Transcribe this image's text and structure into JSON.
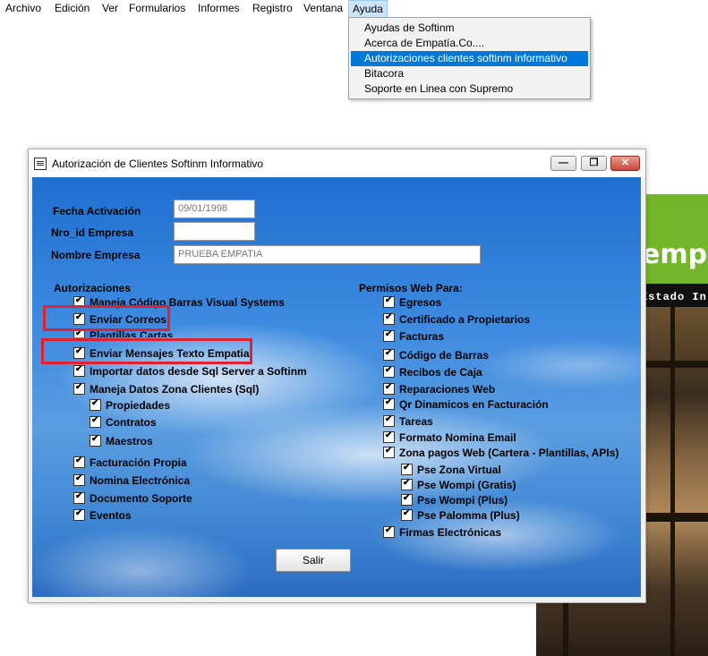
{
  "menu": {
    "items": [
      "Archivo",
      "Edición",
      "Ver",
      "Formularios",
      "Informes",
      "Registro",
      "Ventana",
      "Ayuda"
    ]
  },
  "dropdown": {
    "items": [
      "Ayudas de Softinm",
      "Acerca de Empatía.Co....",
      "Autorizaciones clientes softinm informativo",
      "Bitacora",
      "Soporte en Linea con Supremo"
    ],
    "selected_index": 2
  },
  "site": {
    "brand": "emp",
    "strip": "Estado In"
  },
  "dialog": {
    "title": "Autorización de Clientes Softinm Informativo",
    "fields": {
      "fecha_label": "Fecha Activación",
      "fecha_value": "09/01/1998",
      "nro_label": "Nro_id Empresa",
      "nro_value": "",
      "nombre_label": "Nombre Empresa",
      "nombre_value": "PRUEBA EMPATIA"
    },
    "autorizaciones": {
      "label": "Autorizaciones",
      "items": [
        {
          "label": "Maneja Código Barras Visual Systems",
          "checked": true
        },
        {
          "label": "Enviar Correos",
          "checked": true
        },
        {
          "label": "Plantillas Cartas",
          "checked": true
        },
        {
          "label": "Enviar Mensajes Texto Empatia",
          "checked": true
        },
        {
          "label": "Importar datos desde Sql Server a Softinm",
          "checked": true
        },
        {
          "label": "Maneja Datos Zona Clientes (Sql)",
          "checked": true
        },
        {
          "label": "Propiedades",
          "checked": true
        },
        {
          "label": "Contratos",
          "checked": true
        },
        {
          "label": "Maestros",
          "checked": true
        },
        {
          "label": "Facturación Propia",
          "checked": true
        },
        {
          "label": "Nomina Electrónica",
          "checked": true
        },
        {
          "label": "Documento Soporte",
          "checked": true
        },
        {
          "label": "Eventos",
          "checked": true
        }
      ]
    },
    "permisos": {
      "label": "Permisos Web Para:",
      "items": [
        {
          "label": "Egresos",
          "checked": true
        },
        {
          "label": "Certificado a Propietarios",
          "checked": true
        },
        {
          "label": "Facturas",
          "checked": true
        },
        {
          "label": "Código de Barras",
          "checked": true
        },
        {
          "label": "Recibos de Caja",
          "checked": true
        },
        {
          "label": "Reparaciones Web",
          "checked": true
        },
        {
          "label": "Qr Dinamicos en Facturación",
          "checked": true
        },
        {
          "label": "Tareas",
          "checked": true
        },
        {
          "label": "Formato Nomina Email",
          "checked": true
        },
        {
          "label": "Zona pagos Web (Cartera - Plantillas, APIs)",
          "checked": true
        },
        {
          "label": "Pse Zona Virtual",
          "checked": true
        },
        {
          "label": "Pse Wompi (Gratis)",
          "checked": true
        },
        {
          "label": "Pse Wompi (Plus)",
          "checked": true
        },
        {
          "label": "Pse Palomma (Plus)",
          "checked": true
        },
        {
          "label": "Firmas Electrónicas",
          "checked": true
        }
      ]
    },
    "salir_label": "Salir"
  },
  "colors": {
    "highlight": "#e0212f",
    "selection": "#0078d7"
  }
}
